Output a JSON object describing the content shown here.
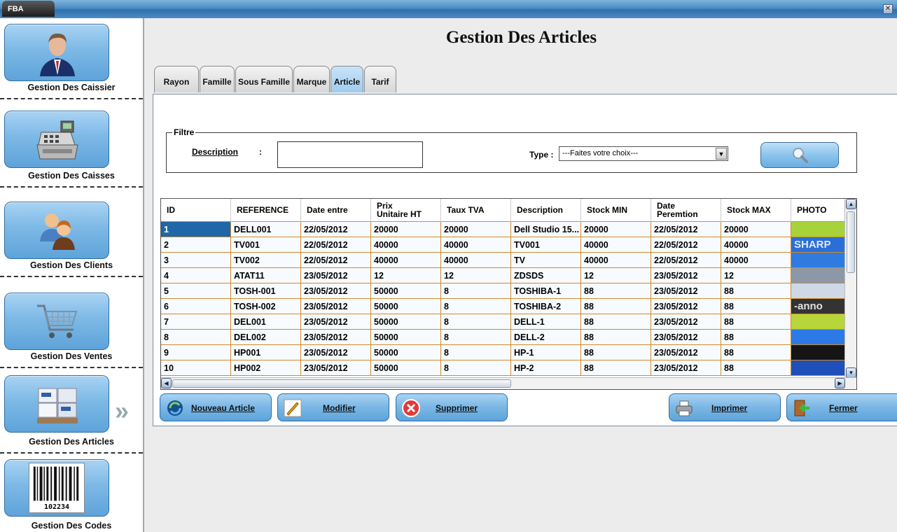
{
  "window": {
    "app_tab": "FBA",
    "close_symbol": "✕"
  },
  "sidebar": {
    "items": [
      {
        "label": "Gestion Des Caissier",
        "icon": "businessman-icon"
      },
      {
        "label": "Gestion Des Caisses",
        "icon": "cash-register-icon"
      },
      {
        "label": "Gestion Des Clients",
        "icon": "users-icon"
      },
      {
        "label": "Gestion Des Ventes",
        "icon": "shopping-cart-icon"
      },
      {
        "label": "Gestion Des Articles",
        "icon": "boxes-icon"
      },
      {
        "label": "Gestion Des Codes",
        "icon": "barcode-icon"
      }
    ],
    "barcode_number": "102234",
    "active_indicator": "»"
  },
  "main": {
    "title": "Gestion Des Articles",
    "tabs": [
      "Rayon",
      "Famille",
      "Sous Famille",
      "Marque",
      "Article",
      "Tarif"
    ],
    "active_tab": "Article",
    "filter": {
      "legend": "Filtre",
      "description_label": "Description",
      "description_colon": ":",
      "description_value": "",
      "type_label": "Type :",
      "type_value": "---Faites votre choix---"
    },
    "grid": {
      "columns": [
        "ID",
        "REFERENCE",
        "Date entre",
        "Prix\nUnitaire HT",
        "Taux TVA",
        "Description",
        "Stock MIN",
        "Date\nPeremtion",
        "Stock MAX",
        "PHOTO"
      ],
      "rows": [
        [
          "1",
          "DELL001",
          "22/05/2012",
          "20000",
          "20000",
          "Dell Studio 15...",
          "20000",
          "22/05/2012",
          "20000"
        ],
        [
          "2",
          "TV001",
          "22/05/2012",
          "40000",
          "40000",
          "TV001",
          "40000",
          "22/05/2012",
          "40000"
        ],
        [
          "3",
          "TV002",
          "22/05/2012",
          "40000",
          "40000",
          "TV",
          "40000",
          "22/05/2012",
          "40000"
        ],
        [
          "4",
          "ATAT11",
          "23/05/2012",
          "12",
          "12",
          "ZDSDS",
          "12",
          "23/05/2012",
          "12"
        ],
        [
          "5",
          "TOSH-001",
          "23/05/2012",
          "50000",
          "8",
          "TOSHIBA-1",
          "88",
          "23/05/2012",
          "88"
        ],
        [
          "6",
          "TOSH-002",
          "23/05/2012",
          "50000",
          "8",
          "TOSHIBA-2",
          "88",
          "23/05/2012",
          "88"
        ],
        [
          "7",
          "DEL001",
          "23/05/2012",
          "50000",
          "8",
          "DELL-1",
          "88",
          "23/05/2012",
          "88"
        ],
        [
          "8",
          "DEL002",
          "23/05/2012",
          "50000",
          "8",
          "DELL-2",
          "88",
          "23/05/2012",
          "88"
        ],
        [
          "9",
          "HP001",
          "23/05/2012",
          "50000",
          "8",
          "HP-1",
          "88",
          "23/05/2012",
          "88"
        ],
        [
          "10",
          "HP002",
          "23/05/2012",
          "50000",
          "8",
          "HP-2",
          "88",
          "23/05/2012",
          "88"
        ]
      ],
      "photo_colors": [
        "#a8d23a",
        "#2b6fd6",
        "#2f7be0",
        "#8c98a8",
        "#cfd9e6",
        "#333333",
        "#b6d63a",
        "#2c7ae8",
        "#151515",
        "#1f4fb8"
      ],
      "photo_text": {
        "row2": "SHARP",
        "row6": "-anno"
      },
      "selected_row_index": 0
    },
    "actions": {
      "new": "Nouveau Article",
      "edit": "Modifier",
      "delete": "Supprimer",
      "print": "Imprimer",
      "close": "Fermer"
    }
  }
}
